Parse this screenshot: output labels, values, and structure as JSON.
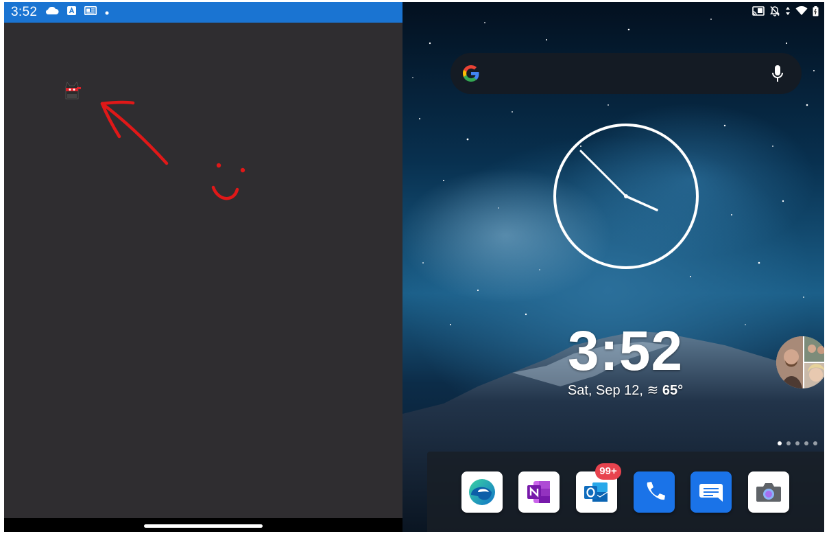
{
  "left_pane": {
    "status_time": "3:52",
    "status_icons": [
      "cloud-icon",
      "app-store-icon",
      "news-icon",
      "dot-icon"
    ]
  },
  "right_pane": {
    "status_icons": [
      "cast-icon",
      "bell-muted-icon",
      "data-arrows-icon",
      "wifi-icon",
      "battery-icon"
    ],
    "search_bar": {
      "logo": "google-g-icon",
      "mic": "mic-icon"
    },
    "clock_time": "3:52",
    "date": "Sat, Sep 12,",
    "weather_icon": "haze-icon",
    "temperature": "65°",
    "page_indicator": {
      "count": 5,
      "active": 1
    },
    "dock": {
      "apps": [
        {
          "name": "Edge",
          "icon": "edge-icon"
        },
        {
          "name": "OneNote",
          "icon": "onenote-icon"
        },
        {
          "name": "Outlook",
          "icon": "outlook-icon",
          "badge": "99+"
        },
        {
          "name": "Phone",
          "icon": "phone-icon"
        },
        {
          "name": "Messages",
          "icon": "messages-icon"
        },
        {
          "name": "Camera",
          "icon": "camera-icon"
        }
      ]
    }
  },
  "colors": {
    "status_bar_blue": "#1a74d2",
    "left_background": "#2f2d30",
    "drawing_red": "#e01818",
    "badge_red": "#e8434e"
  }
}
